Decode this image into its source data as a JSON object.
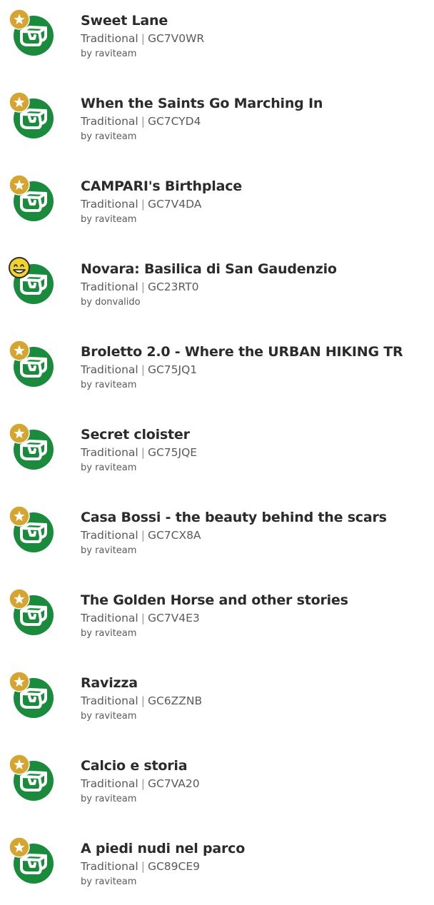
{
  "colors": {
    "cache_icon_green": "#1a8a3c",
    "star_badge_gold": "#d6a531",
    "smiley_badge_yellow": "#f2d22e",
    "title_text": "#2b2b2b",
    "meta_text": "#5a5a5a"
  },
  "caches": [
    {
      "title": "Sweet Lane",
      "type": "Traditional",
      "separator": "|",
      "code": "GC7V0WR",
      "owner": "by raviteam",
      "badge_icon": "star-badge-icon"
    },
    {
      "title": "When the Saints Go Marching In",
      "type": "Traditional",
      "separator": "|",
      "code": "GC7CYD4",
      "owner": "by raviteam",
      "badge_icon": "star-badge-icon"
    },
    {
      "title": "CAMPARI's Birthplace",
      "type": "Traditional",
      "separator": "|",
      "code": "GC7V4DA",
      "owner": "by raviteam",
      "badge_icon": "star-badge-icon"
    },
    {
      "title": "Novara: Basilica di San Gaudenzio",
      "type": "Traditional",
      "separator": "|",
      "code": "GC23RT0",
      "owner": "by donvalido",
      "badge_icon": "smiley-badge-icon"
    },
    {
      "title": "Broletto 2.0 - Where the URBAN HIKING TR",
      "type": "Traditional",
      "separator": "|",
      "code": "GC75JQ1",
      "owner": "by raviteam",
      "badge_icon": "star-badge-icon"
    },
    {
      "title": "Secret cloister",
      "type": "Traditional",
      "separator": "|",
      "code": "GC75JQE",
      "owner": "by raviteam",
      "badge_icon": "star-badge-icon"
    },
    {
      "title": "Casa Bossi - the beauty behind the scars",
      "type": "Traditional",
      "separator": "|",
      "code": "GC7CX8A",
      "owner": "by raviteam",
      "badge_icon": "star-badge-icon"
    },
    {
      "title": "The Golden Horse and other stories",
      "type": "Traditional",
      "separator": "|",
      "code": "GC7V4E3",
      "owner": "by raviteam",
      "badge_icon": "star-badge-icon"
    },
    {
      "title": "Ravizza",
      "type": "Traditional",
      "separator": "|",
      "code": "GC6ZZNB",
      "owner": "by raviteam",
      "badge_icon": "star-badge-icon"
    },
    {
      "title": "Calcio e storia",
      "type": "Traditional",
      "separator": "|",
      "code": "GC7VA20",
      "owner": "by raviteam",
      "badge_icon": "star-badge-icon"
    },
    {
      "title": "A piedi nudi nel parco",
      "type": "Traditional",
      "separator": "|",
      "code": "GC89CE9",
      "owner": "by raviteam",
      "badge_icon": "star-badge-icon"
    }
  ]
}
